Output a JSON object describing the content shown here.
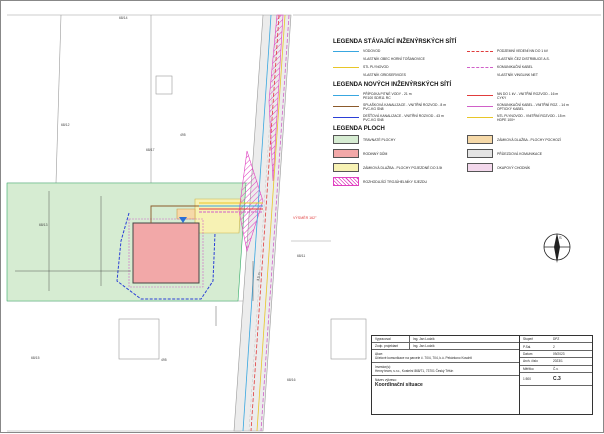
{
  "legend": {
    "existing_title": "LEGENDA STÁVAJÍCÍ INŽENÝRSKÝCH SÍTÍ",
    "existing": [
      {
        "label": "VODOVOD",
        "color": "#39a7e0",
        "style": "solid"
      },
      {
        "label": "PODZEMNÍ VEDENÍ NN DO 1 kV",
        "color": "#e03c3c",
        "style": "dash"
      },
      {
        "label": "VLASTNÍK OBEC HORNÍ TOŠANOVICE",
        "color": "",
        "style": "none"
      },
      {
        "label": "VLASTNÍK ČEZ DISTRIBUCE A.S.",
        "color": "",
        "style": "none"
      },
      {
        "label": "STL PLYNOVOD",
        "color": "#e8c628",
        "style": "solid"
      },
      {
        "label": "KOMUNIKAČNÍ KABEL",
        "color": "#d060c8",
        "style": "dash"
      },
      {
        "label": "VLASTNÍK GRIDSERVICES",
        "color": "",
        "style": "none"
      },
      {
        "label": "VLASTNÍK VINGLINK NET",
        "color": "",
        "style": "none"
      }
    ],
    "new_title": "LEGENDA NOVÝCH INŽENÝRSKÝCH SÍTÍ",
    "new": [
      {
        "label": "PŘÍPOJKA PITNÉ VODY - 21 m",
        "sub": "PE100 SDR11 RC",
        "color": "#39a7e0",
        "style": "arrow"
      },
      {
        "label": "NN DO 1 kV - VNITŘNÍ ROZVOD - 16 m",
        "sub": "CYKY",
        "color": "#e03c3c",
        "style": "arrow"
      },
      {
        "label": "SPLAŠKOVÁ KANALIZACE - VNITŘNÍ ROZVOD - 8 m",
        "sub": "PVC-KG SN8",
        "color": "#8b5a2b",
        "style": "arrow"
      },
      {
        "label": "KOMUNIKAČNÍ KABEL - VNITŘNÍ ROZ. - 14 m",
        "sub": "OPTICKÝ KABEL",
        "color": "#d060c8",
        "style": "arrow"
      },
      {
        "label": "DEŠŤOVÁ KANALIZACE - VNITŘNÍ ROZVOD - 43 m",
        "sub": "PVC-KG SN8",
        "color": "#2b3fd6",
        "style": "arrow"
      },
      {
        "label": "NTL PLYNOVOD - VNITŘNÍ ROZVOD - 15 m",
        "sub": "HDPE 100+",
        "color": "#e8c628",
        "style": "arrow"
      }
    ],
    "areas_title": "LEGENDA PLOCH",
    "areas": [
      {
        "label": "TRAVNATÉ PLOCHY",
        "color": "#d6ecd2"
      },
      {
        "label": "ZÁMKOVÁ DLAŽBA - PLOCHY POCHOZÍ",
        "color": "#f6d9a8"
      },
      {
        "label": "RODINNÝ DŮM",
        "color": "#f2a8a8"
      },
      {
        "label": "PŘÍJEZDOVÁ KOMUNIKACE",
        "color": "#e4e4e4"
      },
      {
        "label": "ZÁMKOVÁ DLAŽBA - PLOCHY POJEZDNÉ DO 3.5t",
        "color": "#f7f2b4"
      },
      {
        "label": "OKAPOVÝ CHODNÍK",
        "color": "#f3d8ec"
      },
      {
        "label": "ROZHODUJÍCÍ TROJÚHELNÍKY SJEZDU",
        "color": "hatch-magenta"
      }
    ]
  },
  "map": {
    "parcel_labels": [
      "68/14",
      "68/12",
      "495",
      "68/17",
      "68/13",
      "68/11",
      "68/15",
      "495",
      "68/16"
    ],
    "annotations": [
      "VÝSMĚR 162°",
      "3,5 m"
    ]
  },
  "titleblock": {
    "rows": [
      {
        "k": "Vypracoval",
        "v": "Ing. Jan Lodzík"
      },
      {
        "k": "Zodp. projektant",
        "v": "Ing. Jan Lodzík"
      }
    ],
    "akce_label": "Akce:",
    "akce_text": "Účelové komunikace na parcele č. 70/4, 704, k.ú. Pekárkovo Koschtl",
    "investor_label": "Investor(s):",
    "investor_text": "Henry team, s.r.o., Kostelní 868/71, 73701 Český Těšín",
    "drawing_label": "Název výkresu:",
    "drawing_name": "Koordinační situace",
    "right": [
      {
        "k": "Stupeň",
        "v": "DPZ"
      },
      {
        "k": "P.Sal.",
        "v": "2"
      },
      {
        "k": "Datum",
        "v": "09/2023"
      },
      {
        "k": "Arch. číslo",
        "v": "2023/1"
      },
      {
        "k": "Měřítko",
        "v": "Č.v."
      }
    ],
    "scale": "1:500",
    "sheet": "C.3"
  },
  "north": "S"
}
